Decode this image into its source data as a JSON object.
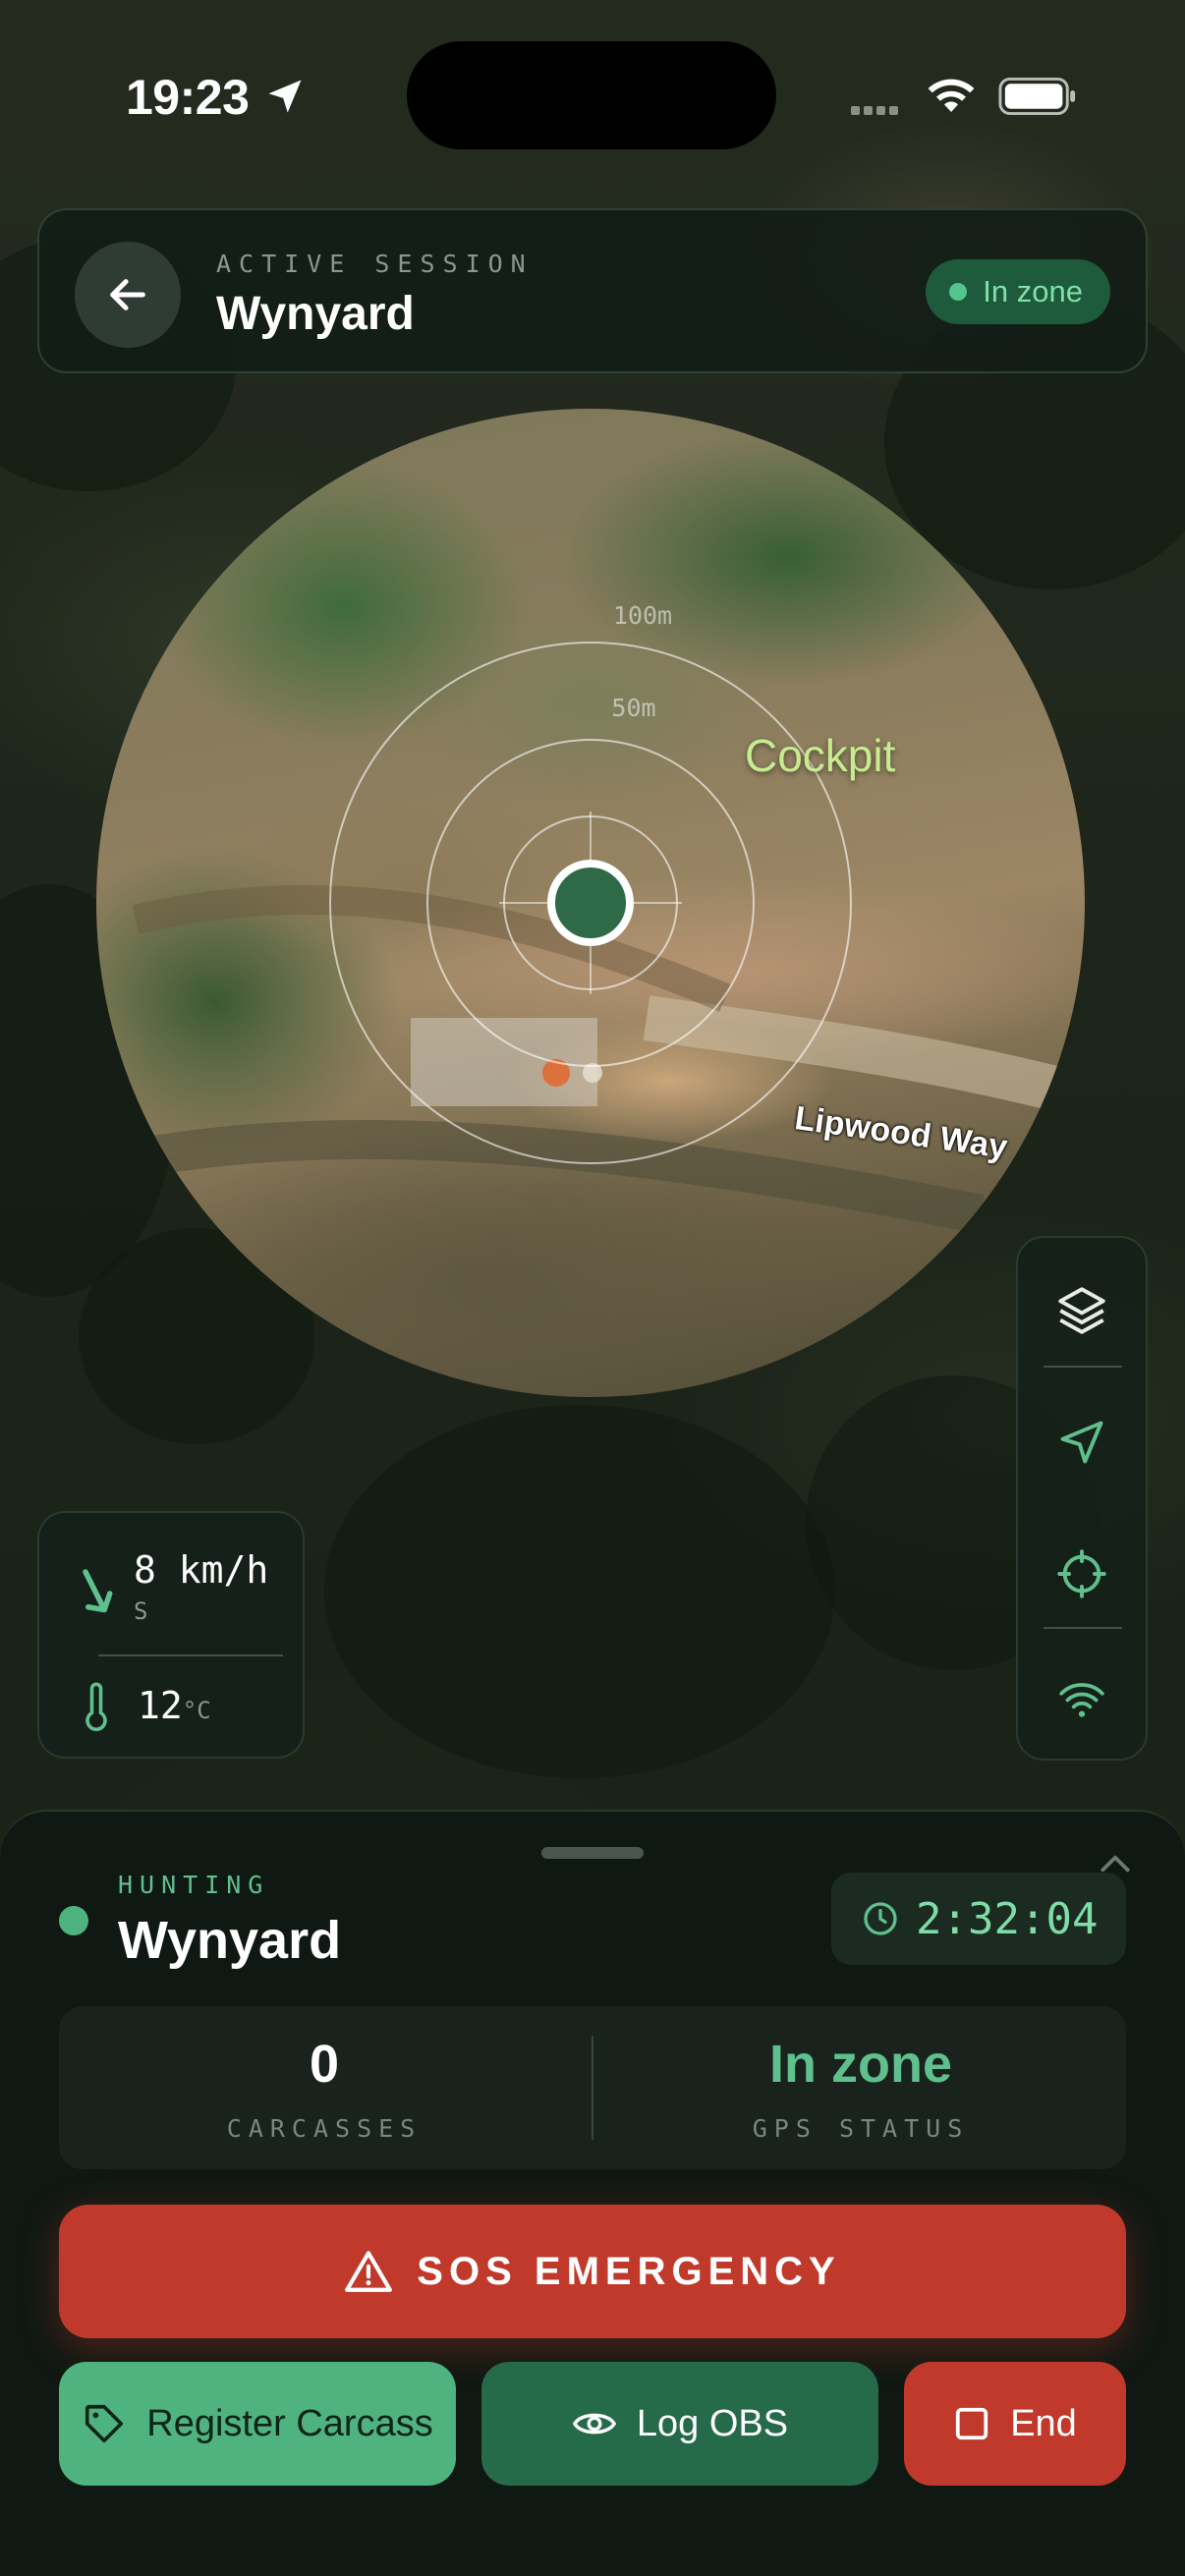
{
  "status_bar": {
    "time": "19:23"
  },
  "header": {
    "label": "ACTIVE SESSION",
    "title": "Wynyard",
    "zone_badge": "In zone"
  },
  "map": {
    "ring_labels": [
      "100m",
      "50m"
    ],
    "poi_label": "Cockpit",
    "road_label": "Lipwood Way"
  },
  "tools": {
    "icons": [
      "layers-icon",
      "navigate-icon",
      "crosshair-icon",
      "signal-icon"
    ]
  },
  "weather": {
    "speed": "8 km/h",
    "direction": "S",
    "temperature": "12",
    "temperature_unit": "°C"
  },
  "sheet": {
    "activity_label": "HUNTING",
    "activity_name": "Wynyard",
    "timer": "2:32:04",
    "stats": {
      "carcasses_value": "0",
      "carcasses_label": "CARCASSES",
      "gps_value": "In zone",
      "gps_label": "GPS STATUS"
    },
    "sos_label": "SOS EMERGENCY",
    "actions": {
      "register": "Register Carcass",
      "log_obs": "Log OBS",
      "end": "End"
    }
  },
  "colors": {
    "accent_green": "#4fb380",
    "zone_text": "#7fe0a8",
    "danger_red": "#c0392b",
    "poi_label": "#c7ec8e",
    "sheet_bg": "#101813"
  }
}
